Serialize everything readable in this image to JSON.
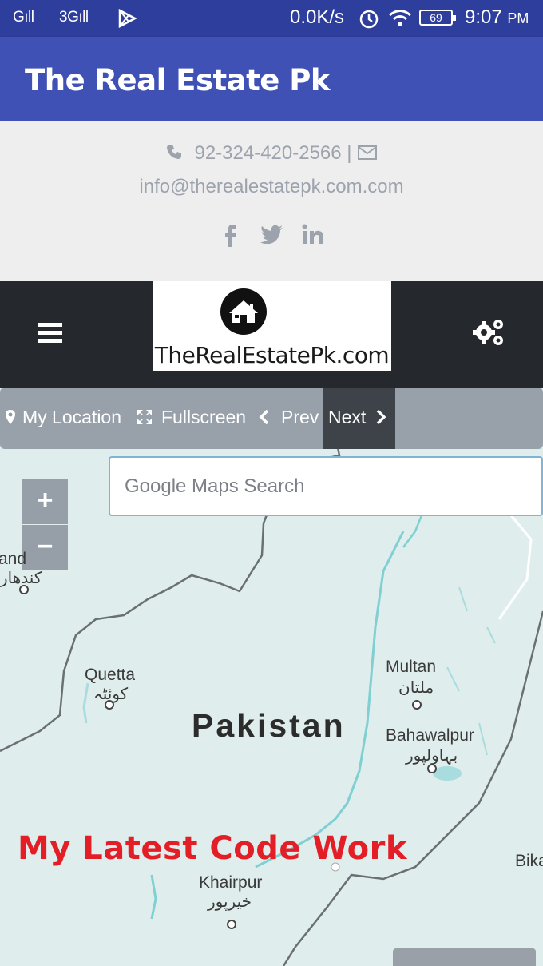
{
  "status_bar": {
    "signal_1": "Gıll",
    "signal_2": "3Gıll",
    "network_speed": "0.0K/s",
    "battery": "69",
    "time": "9:07",
    "time_suffix": "PM"
  },
  "app_bar": {
    "title": "The Real Estate Pk"
  },
  "contact": {
    "phone": "92-324-420-2566",
    "separator": "|",
    "email": "info@therealestatepk.com.com",
    "social_icons": [
      "facebook-icon",
      "twitter-icon",
      "linkedin-icon"
    ]
  },
  "nav": {
    "logo_text": "TheRealEstatePk.com",
    "menu_icon": "hamburger-icon",
    "settings_icon": "gears-icon"
  },
  "map": {
    "toolbar": {
      "my_location": "My Location",
      "fullscreen": "Fullscreen",
      "prev": "Prev",
      "next": "Next"
    },
    "search_placeholder": "Google Maps Search",
    "zoom_in": "+",
    "zoom_out": "−",
    "country": "Pakistan",
    "cities": {
      "quetta": "Quetta",
      "quetta_urdu": "کوئٹہ",
      "multan": "Multan",
      "multan_urdu": "ملتان",
      "bahawalpur": "Bahawalpur",
      "bahawalpur_urdu": "بہاولپور",
      "khairpur": "Khairpur",
      "khairpur_urdu": "خیرپور",
      "kandahar_partial": "and",
      "kandahar_urdu": "کندھار",
      "bikaner_partial": "Bika"
    },
    "overlay_text": "My Latest Code Work"
  },
  "colors": {
    "status_bar": "#2e3e9c",
    "app_bar": "#3f51b5",
    "nav_bar": "#25282c",
    "map_land": "#dfeeec",
    "overlay_text": "#e41e26"
  }
}
